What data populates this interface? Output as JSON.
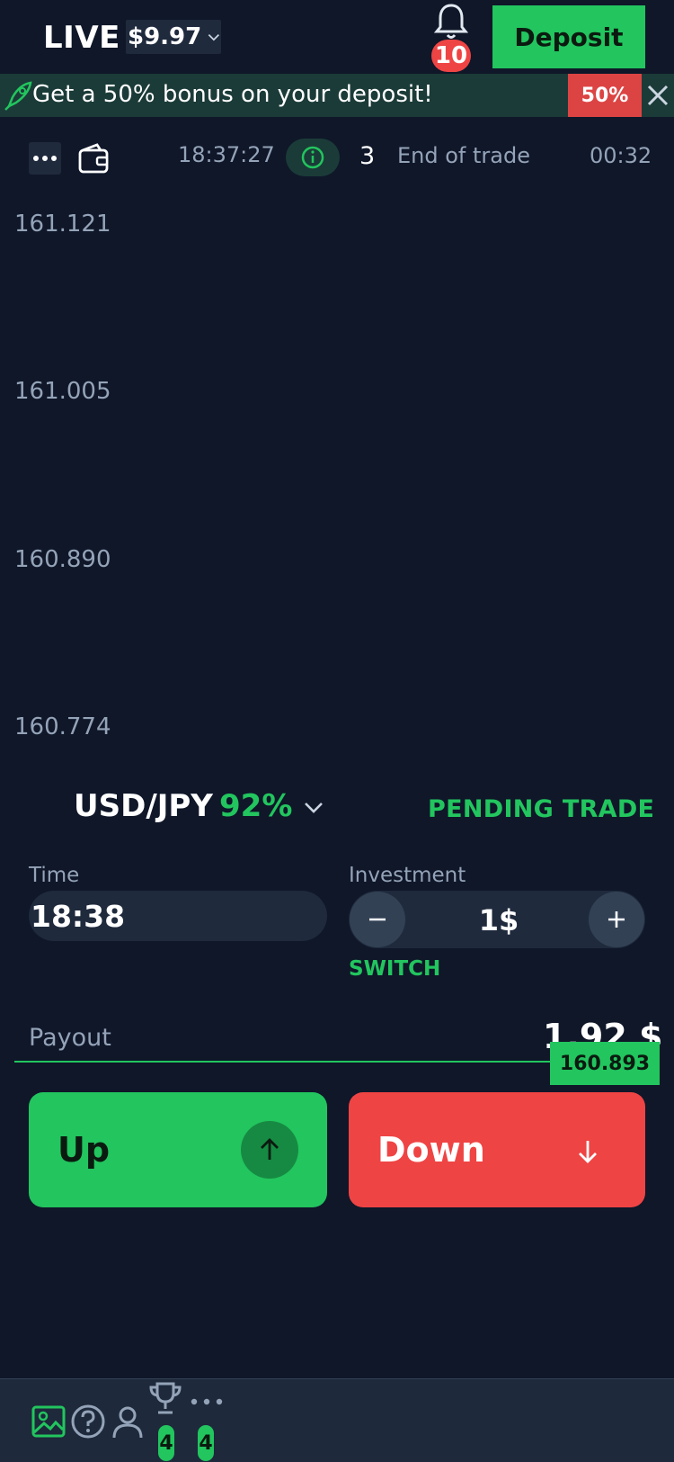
{
  "header": {
    "mode_label": "LIVE",
    "balance": "$9.97",
    "notification_count": "10",
    "deposit_label": "Deposit"
  },
  "banner": {
    "text": "Get a 50% bonus on your deposit!",
    "bonus_label": "50%"
  },
  "toolbar": {
    "clock": "18:37:27",
    "trade_count": "3",
    "end_of_trade_label": "End of trade",
    "end_of_trade_time": "00:32"
  },
  "chart_prices": [
    "161.121",
    "161.005",
    "160.890",
    "160.774"
  ],
  "asset": {
    "pair": "USD/JPY",
    "payout_percent": "92%",
    "pending_trade_label": "PENDING TRADE"
  },
  "time": {
    "label": "Time",
    "value": "18:38"
  },
  "investment": {
    "label": "Investment",
    "value": "1$",
    "switch_label": "SWITCH"
  },
  "payout": {
    "label": "Payout",
    "value": "1.92 $",
    "current_price": "160.893"
  },
  "trade": {
    "up_label": "Up",
    "down_label": "Down"
  },
  "bottom_nav": {
    "badges": [
      "4",
      "4"
    ]
  },
  "colors": {
    "background": "#0f1729",
    "accent_green": "#22c55e",
    "accent_red": "#ef4444"
  }
}
